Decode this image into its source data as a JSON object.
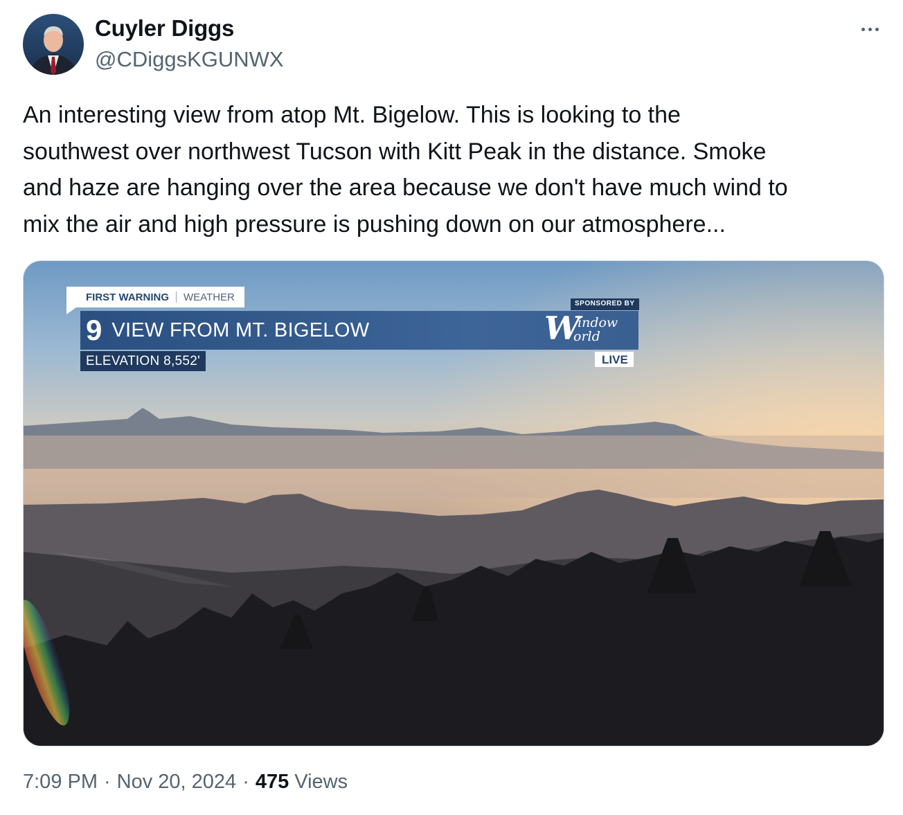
{
  "tweet": {
    "author": {
      "display_name": "Cuyler Diggs",
      "handle": "@CDiggsKGUNWX"
    },
    "menu_icon": "more-horizontal-icon",
    "text": "An interesting view from atop Mt. Bigelow.  This is looking to the\nsouthwest over northwest Tucson with Kitt Peak in the distance.  Smoke\nand haze are hanging over the area because we don't have much wind to\nmix the air and high pressure is pushing down on our atmosphere...",
    "media": {
      "overlay": {
        "tab_first": "FIRST WARNING",
        "tab_weather": "WEATHER",
        "channel_number": "9",
        "title": "VIEW FROM MT. BIGELOW",
        "elevation": "ELEVATION 8,552'",
        "sponsored_by": "SPONSORED BY",
        "sponsor_logo_w": "W",
        "sponsor_logo_line1": "indow",
        "sponsor_logo_line2": "orld",
        "live": "LIVE"
      }
    },
    "meta": {
      "time": "7:09 PM",
      "separator": "·",
      "date": "Nov 20, 2024",
      "views_count": "475",
      "views_label": "Views"
    }
  }
}
